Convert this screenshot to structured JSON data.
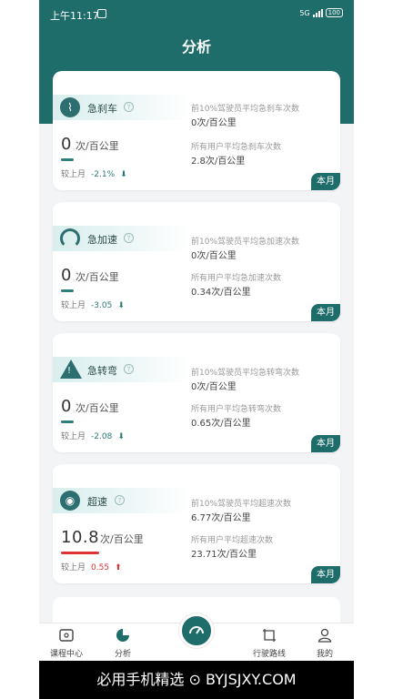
{
  "status": {
    "time": "上午11:17",
    "network": "5G",
    "battery": "100"
  },
  "page_title": "分析",
  "cards": [
    {
      "name": "急刹车",
      "icon": "car-brake-icon",
      "value": "0",
      "unit": "次/百公里",
      "last_label": "较上月",
      "last_delta": "-2.1%",
      "trend": "down",
      "stat1_label": "前10%驾驶员平均急刹车次数",
      "stat1_value": "0次/百公里",
      "stat2_label": "所有用户平均急刹车次数",
      "stat2_value": "2.8次/百公里",
      "period": "本月"
    },
    {
      "name": "急加速",
      "icon": "speedometer-icon",
      "value": "0",
      "unit": "次/百公里",
      "last_label": "较上月",
      "last_delta": "-3.05",
      "trend": "down",
      "stat1_label": "前10%驾驶员平均急加速次数",
      "stat1_value": "0次/百公里",
      "stat2_label": "所有用户平均急加速次数",
      "stat2_value": "0.34次/百公里",
      "period": "本月"
    },
    {
      "name": "急转弯",
      "icon": "warning-triangle-icon",
      "value": "0",
      "unit": "次/百公里",
      "last_label": "较上月",
      "last_delta": "-2.08",
      "trend": "down",
      "stat1_label": "前10%驾驶员平均急转弯次数",
      "stat1_value": "0次/百公里",
      "stat2_label": "所有用户平均急转弯次数",
      "stat2_value": "0.65次/百公里",
      "period": "本月"
    },
    {
      "name": "超速",
      "icon": "speed-camera-icon",
      "value": "10.8",
      "unit": "次/百公里",
      "last_label": "较上月",
      "last_delta": "0.55",
      "trend": "up",
      "stat1_label": "前10%驾驶员平均超速次数",
      "stat1_value": "6.77次/百公里",
      "stat2_label": "所有用户平均超速次数",
      "stat2_value": "23.71次/百公里",
      "period": "本月"
    }
  ],
  "tabs": [
    {
      "label": "课程中心",
      "icon": "video-icon"
    },
    {
      "label": "分析",
      "icon": "pie-chart-icon",
      "active": true
    },
    {
      "label": "",
      "icon": "dashboard-icon"
    },
    {
      "label": "行驶路线",
      "icon": "route-icon"
    },
    {
      "label": "我的",
      "icon": "user-icon"
    }
  ],
  "footer": "必用手机精选 ⊙ BYJSJXY.COM",
  "colors": {
    "primary": "#1e6d6a",
    "up": "#dd3333",
    "down": "#2a7a78"
  }
}
